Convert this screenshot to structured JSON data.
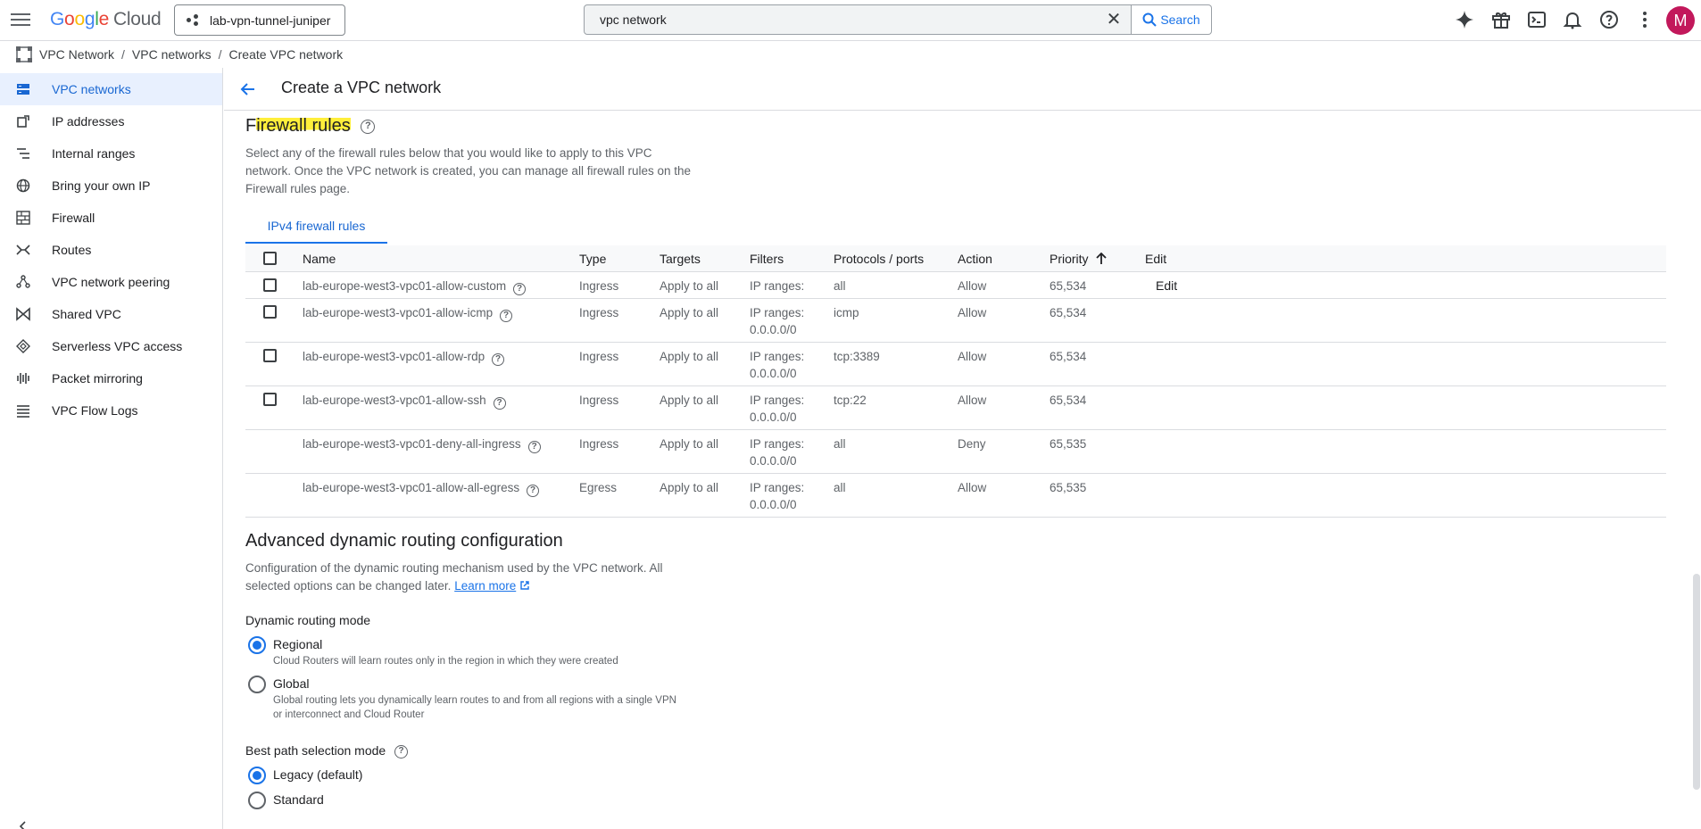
{
  "topbar": {
    "logo_parts": [
      "G",
      "o",
      "o",
      "g",
      "l",
      "e"
    ],
    "logo_cloud": "Cloud",
    "project_name": "lab-vpn-tunnel-juniper",
    "search_value": "vpc network",
    "search_label": "Search",
    "avatar_letter": "M"
  },
  "breadcrumb": {
    "items": [
      "VPC Network",
      "VPC networks",
      "Create VPC network"
    ],
    "separator": "/"
  },
  "sidebar": {
    "items": [
      {
        "label": "VPC networks",
        "icon": "vpc-networks-icon"
      },
      {
        "label": "IP addresses",
        "icon": "ip-addresses-icon"
      },
      {
        "label": "Internal ranges",
        "icon": "internal-ranges-icon"
      },
      {
        "label": "Bring your own IP",
        "icon": "globe-icon"
      },
      {
        "label": "Firewall",
        "icon": "firewall-icon"
      },
      {
        "label": "Routes",
        "icon": "routes-icon"
      },
      {
        "label": "VPC network peering",
        "icon": "peering-icon"
      },
      {
        "label": "Shared VPC",
        "icon": "shared-vpc-icon"
      },
      {
        "label": "Serverless VPC access",
        "icon": "serverless-icon"
      },
      {
        "label": "Packet mirroring",
        "icon": "packet-mirroring-icon"
      },
      {
        "label": "VPC Flow Logs",
        "icon": "flow-logs-icon"
      }
    ]
  },
  "header": {
    "title": "Create a VPC network"
  },
  "firewall": {
    "title_highlight": "irewall rules",
    "title_prefix": "F",
    "description_lines": [
      "Select any of the firewall rules below that you would like to apply to this VPC",
      "network. Once the VPC network is created, you can manage all firewall rules on the",
      "Firewall rules page."
    ],
    "tab_label": "IPv4 firewall rules",
    "columns": {
      "name": "Name",
      "type": "Type",
      "targets": "Targets",
      "filters": "Filters",
      "protocols": "Protocols / ports",
      "action": "Action",
      "priority": "Priority",
      "edit": "Edit"
    },
    "sort_icon": "arrow-up-icon",
    "rows": [
      {
        "name": "lab-europe-west3-vpc01-allow-custom",
        "type": "Ingress",
        "targets": "Apply to all",
        "filters_1": "IP ranges:",
        "filters_2": "",
        "protocols": "all",
        "action": "Allow",
        "priority": "65,534",
        "edit": "Edit"
      },
      {
        "name": "lab-europe-west3-vpc01-allow-icmp",
        "type": "Ingress",
        "targets": "Apply to all",
        "filters_1": "IP ranges:",
        "filters_2": "0.0.0.0/0",
        "protocols": "icmp",
        "action": "Allow",
        "priority": "65,534",
        "edit": ""
      },
      {
        "name": "lab-europe-west3-vpc01-allow-rdp",
        "type": "Ingress",
        "targets": "Apply to all",
        "filters_1": "IP ranges:",
        "filters_2": "0.0.0.0/0",
        "protocols": "tcp:3389",
        "action": "Allow",
        "priority": "65,534",
        "edit": ""
      },
      {
        "name": "lab-europe-west3-vpc01-allow-ssh",
        "type": "Ingress",
        "targets": "Apply to all",
        "filters_1": "IP ranges:",
        "filters_2": "0.0.0.0/0",
        "protocols": "tcp:22",
        "action": "Allow",
        "priority": "65,534",
        "edit": ""
      },
      {
        "name": "lab-europe-west3-vpc01-deny-all-ingress",
        "type": "Ingress",
        "targets": "Apply to all",
        "filters_1": "IP ranges:",
        "filters_2": "0.0.0.0/0",
        "protocols": "all",
        "action": "Deny",
        "priority": "65,535",
        "edit": ""
      },
      {
        "name": "lab-europe-west3-vpc01-allow-all-egress",
        "type": "Egress",
        "targets": "Apply to all",
        "filters_1": "IP ranges:",
        "filters_2": "0.0.0.0/0",
        "protocols": "all",
        "action": "Allow",
        "priority": "65,535",
        "edit": ""
      }
    ]
  },
  "routing": {
    "title": "Advanced dynamic routing configuration",
    "description_1": "Configuration of the dynamic routing mechanism used by the VPC network. All",
    "description_2": "selected options can be changed later.",
    "learn_more": "Learn more",
    "mode_label": "Dynamic routing mode",
    "regional_label": "Regional",
    "regional_sub": "Cloud Routers will learn routes only in the region in which they were created",
    "global_label": "Global",
    "global_sub_1": "Global routing lets you dynamically learn routes to and from all regions with a single VPN",
    "global_sub_2": "or interconnect and Cloud Router",
    "best_path_label": "Best path selection mode",
    "legacy_label": "Legacy (default)",
    "standard_label": "Standard"
  },
  "colors": {
    "accent": "#1a73e8",
    "highlight": "#ffef3b",
    "avatar": "#c2185b"
  }
}
